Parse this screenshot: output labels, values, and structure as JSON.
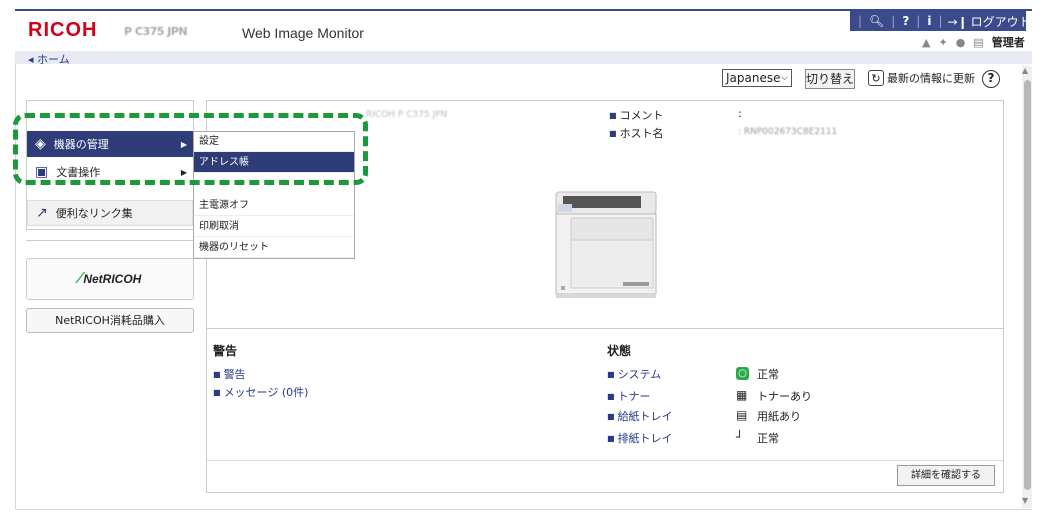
{
  "header": {
    "brand": "RICOH",
    "model": "P C375 JPN",
    "app_title": "Web Image Monitor",
    "top_icons": [
      "search-icon",
      "help-icon",
      "info-icon",
      "logout-icon"
    ],
    "logout_label": "ログアウト",
    "admin_label": "管理者"
  },
  "breadcrumb": "◂ ホーム",
  "toolbar": {
    "language": "Japanese",
    "switch_label": "切り替え",
    "refresh_label": "最新の情報に更新",
    "help_label": "?"
  },
  "nav": {
    "items": [
      {
        "label": "機器の管理",
        "icon": "device-icon",
        "active": true
      },
      {
        "label": "文書操作",
        "icon": "document-icon"
      },
      {
        "label": "便利なリンク集",
        "icon": "link-icon"
      }
    ],
    "netricoh_label": "NetRICOH",
    "supplies_label": "NetRICOH消耗品購入"
  },
  "submenu": {
    "items": [
      "設定",
      "アドレス帳",
      "主電源オフ",
      "印刷取消",
      "機器のリセット"
    ],
    "selected": "アドレス帳"
  },
  "device_info": {
    "model_blurred": "RICOH P C375 JPN",
    "comment_label": "コメント",
    "comment_value": ":",
    "host_label": "ホスト名",
    "host_value": ": RNP002673C8E2111"
  },
  "alerts": {
    "title": "警告",
    "items": [
      "警告",
      "メッセージ (0件)"
    ]
  },
  "status": {
    "title": "状態",
    "rows": [
      {
        "label": "システム",
        "value": "正常",
        "icon": "status-ok-icon"
      },
      {
        "label": "トナー",
        "value": "トナーあり",
        "icon": "toner-icon"
      },
      {
        "label": "給紙トレイ",
        "value": "用紙あり",
        "icon": "paper-tray-icon"
      },
      {
        "label": "排紙トレイ",
        "value": "正常",
        "icon": "output-tray-icon"
      }
    ]
  },
  "detail_button": "詳細を確認する",
  "colors": {
    "brand_red": "#d0021b",
    "nav_active": "#2e3d7a",
    "highlight_green": "#1a9a3a",
    "status_green": "#2eaa4a"
  }
}
